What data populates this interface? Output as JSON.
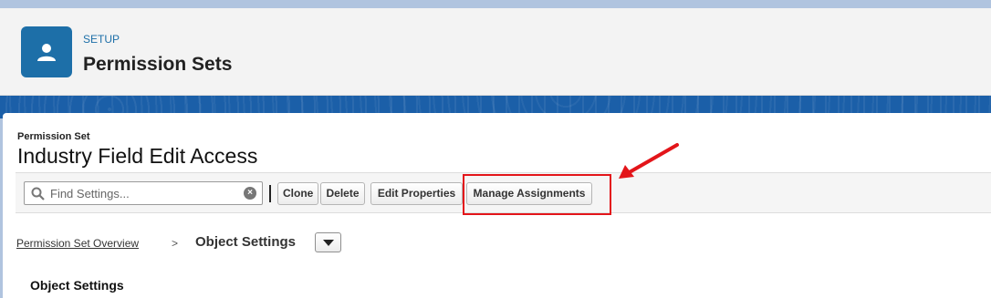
{
  "header": {
    "setup_label": "SETUP",
    "title": "Permission Sets",
    "icon": "user-icon"
  },
  "record": {
    "type_label": "Permission Set",
    "name": "Industry Field Edit Access"
  },
  "toolbar": {
    "search_placeholder": "Find Settings...",
    "search_value": "",
    "buttons": {
      "clone": "Clone",
      "delete": "Delete",
      "edit_properties": "Edit Properties",
      "manage_assignments": "Manage Assignments"
    }
  },
  "breadcrumb": {
    "link": "Permission Set Overview",
    "separator": ">",
    "current": "Object Settings"
  },
  "section": {
    "heading": "Object Settings"
  },
  "annotation": {
    "highlight_color": "#e3151a"
  },
  "colors": {
    "brand_blue": "#1d6fa8",
    "band_blue": "#1b5fa8"
  }
}
